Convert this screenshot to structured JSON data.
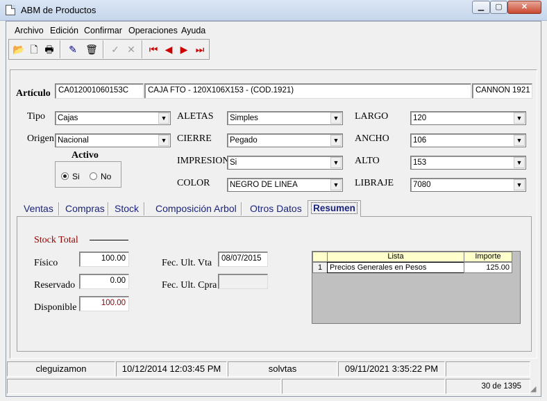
{
  "window": {
    "title": "ABM de Productos",
    "min_glyph": "▁",
    "max_glyph": "▢",
    "close_glyph": "✕"
  },
  "menu": [
    "Archivo",
    "Edición",
    "Confirmar",
    "Operaciones",
    "Ayuda"
  ],
  "toolbar": [
    {
      "name": "open-folder-icon",
      "glyph": "📂",
      "color": "#b8860b"
    },
    {
      "name": "new-document-icon",
      "glyph": "🗋",
      "color": "#000000"
    },
    {
      "name": "print-icon",
      "glyph": "🖶",
      "color": "#000000"
    },
    {
      "name": "edit-pencil-icon",
      "glyph": "✎",
      "color": "#000080"
    },
    {
      "name": "trash-icon",
      "glyph": "🗑",
      "color": "#000000"
    },
    {
      "name": "confirm-check-icon",
      "glyph": "✓",
      "color": "#9e9e9e"
    },
    {
      "name": "cancel-x-icon",
      "glyph": "✕",
      "color": "#9e9e9e"
    },
    {
      "name": "first-record-icon",
      "glyph": "⏮",
      "color": "#cc0000"
    },
    {
      "name": "prev-record-icon",
      "glyph": "◀",
      "color": "#cc0000"
    },
    {
      "name": "next-record-icon",
      "glyph": "▶",
      "color": "#cc0000"
    },
    {
      "name": "last-record-icon",
      "glyph": "⏭",
      "color": "#cc0000"
    }
  ],
  "articulo": {
    "label": "Artículo",
    "code": "CA012001060153C",
    "description": "CAJA FTO - 120X106X153 - (COD.1921)",
    "client": "CANNON 1921"
  },
  "fields": {
    "tipo": {
      "label": "Tipo",
      "value": "Cajas"
    },
    "origen": {
      "label": "Origen",
      "value": "Nacional"
    },
    "aletas": {
      "label": "ALETAS",
      "value": "Simples"
    },
    "cierre": {
      "label": "CIERRE",
      "value": "Pegado"
    },
    "impresion": {
      "label": "IMPRESION",
      "value": "Si"
    },
    "color": {
      "label": "COLOR",
      "value": "NEGRO DE LINEA"
    },
    "largo": {
      "label": "LARGO",
      "value": "120"
    },
    "ancho": {
      "label": "ANCHO",
      "value": "106"
    },
    "alto": {
      "label": "ALTO",
      "value": "153"
    },
    "libraje": {
      "label": "LIBRAJE",
      "value": "7080"
    }
  },
  "activo": {
    "label": "Activo",
    "options": [
      "Si",
      "No"
    ],
    "selected": "Si"
  },
  "tabs": [
    "Ventas",
    "Compras",
    "Stock",
    "Composición Arbol",
    "Otros Datos",
    "Resumen"
  ],
  "active_tab": "Resumen",
  "resumen": {
    "stock_total_label": "Stock Total",
    "fisico": {
      "label": "Físico",
      "value": "100.00"
    },
    "reservado": {
      "label": "Reservado",
      "value": "0.00"
    },
    "disponible": {
      "label": "Disponible",
      "value": "100.00",
      "color": "#8b0000"
    },
    "fec_ult_vta": {
      "label": "Fec. Ult. Vta",
      "value": "08/07/2015"
    },
    "fec_ult_cpra": {
      "label": "Fec. Ult. Cpra",
      "value": ""
    },
    "price_grid": {
      "headers": [
        "Lista",
        "Importe"
      ],
      "rows": [
        {
          "num": "1",
          "lista": "Precios Generales en Pesos",
          "importe": "125.00"
        }
      ]
    }
  },
  "statusbar": {
    "user_created": "cleguizamon",
    "date_created": "10/12/2014 12:03:45 PM",
    "user_modified": "solvtas",
    "date_modified": "09/11/2021 3:35:22 PM",
    "record_position": "30 de 1395"
  }
}
